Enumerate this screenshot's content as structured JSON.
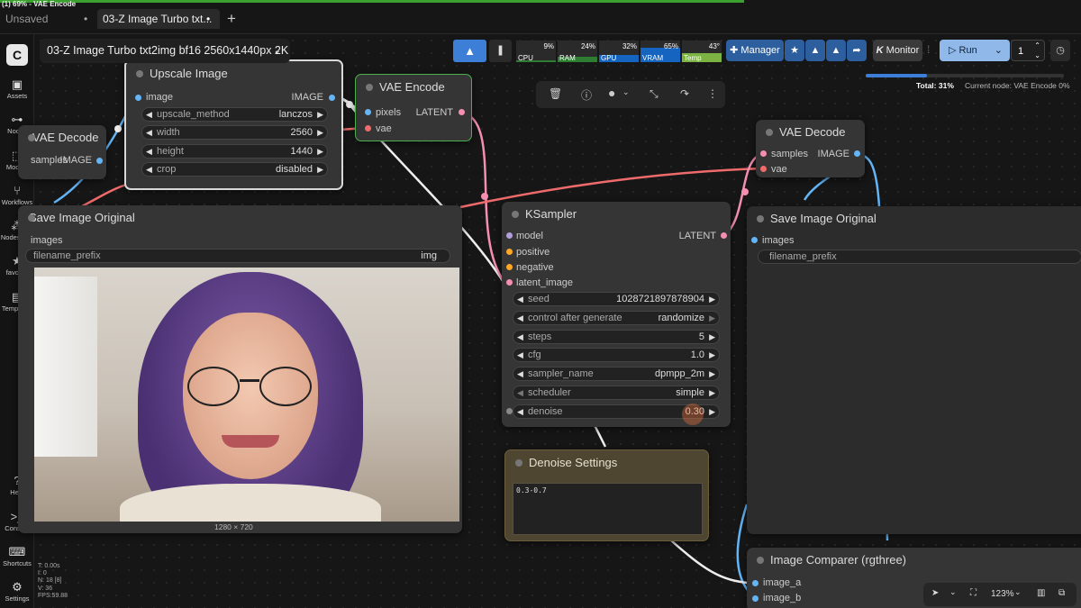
{
  "window_title": "(1) 69% - VAE Encode",
  "tabs": [
    {
      "label": "Unsaved Workflow",
      "marker": "•"
    },
    {
      "label": "03-Z Image Turbo txt...",
      "marker": "•"
    }
  ],
  "new_tab": "+",
  "workflow_name": "03-Z Image Turbo txt2img bf16 2560x1440px 2K",
  "sidebar": [
    {
      "label": "Assets",
      "icon": "▣"
    },
    {
      "label": "Nodes",
      "icon": "⊶"
    },
    {
      "label": "Models",
      "icon": "⬚"
    },
    {
      "label": "Workflows",
      "icon": "⑂"
    },
    {
      "label": "NodesMap",
      "icon": "⁂"
    },
    {
      "label": "favorite",
      "icon": "★"
    },
    {
      "label": "Templates",
      "icon": "▤"
    },
    {
      "label": "Help",
      "icon": "?"
    },
    {
      "label": "Console",
      "icon": ">_"
    },
    {
      "label": "Shortcuts",
      "icon": "⌨"
    },
    {
      "label": "Settings",
      "icon": "⚙"
    }
  ],
  "stats": [
    {
      "label": "CPU",
      "value": "9%",
      "color": "#2e7d32"
    },
    {
      "label": "RAM",
      "value": "24%",
      "color": "#2e7d32"
    },
    {
      "label": "GPU",
      "value": "32%",
      "color": "#1565c0"
    },
    {
      "label": "VRAM",
      "value": "65%",
      "color": "#1565c0"
    },
    {
      "label": "Temp",
      "value": "43°",
      "color": "#7cb342"
    }
  ],
  "toolbar": {
    "manager": "Manager",
    "monitor": "Monitor",
    "run": "Run",
    "queue_count": "1"
  },
  "progress": {
    "total": "Total: 31%",
    "current": "Current node: VAE Encode 0%",
    "total_fraction": 0.31
  },
  "nodes": {
    "upscale": {
      "title": "Upscale Image",
      "input": "image",
      "output": "IMAGE",
      "widgets": [
        {
          "label": "upscale_method",
          "value": "lanczos"
        },
        {
          "label": "width",
          "value": "2560"
        },
        {
          "label": "height",
          "value": "1440"
        },
        {
          "label": "crop",
          "value": "disabled"
        }
      ]
    },
    "vae_encode": {
      "title": "VAE Encode",
      "inputs": [
        "pixels",
        "vae"
      ],
      "output": "LATENT"
    },
    "vae_decode_left": {
      "title": "VAE Decode",
      "input": "samples",
      "output": "IMAGE"
    },
    "vae_decode_right": {
      "title": "VAE Decode",
      "inputs": [
        "samples",
        "vae"
      ],
      "output": "IMAGE"
    },
    "save_left": {
      "title": "Save Image Original",
      "input": "images",
      "prefix_label": "filename_prefix",
      "prefix_value": "img",
      "caption": "1280 × 720"
    },
    "save_right": {
      "title": "Save Image Original",
      "input": "images",
      "prefix_label": "filename_prefix"
    },
    "ksampler": {
      "title": "KSampler",
      "inputs": [
        "model",
        "positive",
        "negative",
        "latent_image"
      ],
      "output": "LATENT",
      "widgets": [
        {
          "label": "seed",
          "value": "1028721897878904"
        },
        {
          "label": "control after generate",
          "value": "randomize"
        },
        {
          "label": "steps",
          "value": "5"
        },
        {
          "label": "cfg",
          "value": "1.0"
        },
        {
          "label": "sampler_name",
          "value": "dpmpp_2m"
        },
        {
          "label": "scheduler",
          "value": "simple"
        },
        {
          "label": "denoise",
          "value": "0.30"
        }
      ]
    },
    "denoise": {
      "title": "Denoise Settings",
      "text": "0.3-0.7"
    },
    "comparer": {
      "title": "Image Comparer (rgthree)",
      "inputs": [
        "image_a",
        "image_b"
      ]
    }
  },
  "stats_overlay": [
    "T: 0.00s",
    "I: 0",
    "N: 18 [8]",
    "V: 36",
    "FPS:59.88"
  ],
  "zoom": "123%",
  "colors": {
    "image": "#64b5f6",
    "latent": "#f48fb1",
    "vae": "#ef6b6b",
    "model": "#b39ddb",
    "cond": "#ffa726",
    "accent": "#3d7fd6"
  }
}
